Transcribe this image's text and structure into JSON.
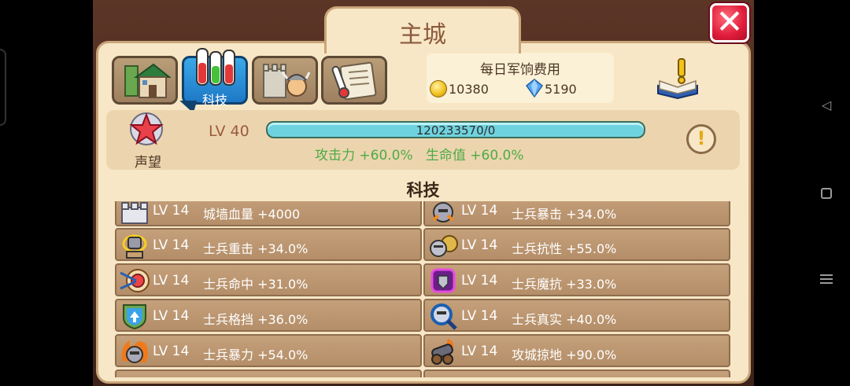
{
  "window": {
    "title": "主城",
    "close_label": "✕"
  },
  "tabs": [
    {
      "name": "castle",
      "label": ""
    },
    {
      "name": "tech",
      "label": "科技",
      "selected": true
    },
    {
      "name": "heroes",
      "label": ""
    },
    {
      "name": "notes",
      "label": ""
    }
  ],
  "cost": {
    "title": "每日军饷费用",
    "gold": "10380",
    "gems": "5190"
  },
  "prestige": {
    "label": "声望",
    "level": "LV 40",
    "progress_text": "120233570/0",
    "progress_fraction": 1.0,
    "bonus": "攻击力 +60.0%   生命值 +60.0%"
  },
  "section_title": "科技",
  "tech_items": [
    {
      "level": "LV 14",
      "name": "城墙血量 +4000",
      "icon": "castle-wall-icon"
    },
    {
      "level": "LV 14",
      "name": "士兵暴击 +34.0%",
      "icon": "knight-crit-icon"
    },
    {
      "level": "LV 14",
      "name": "士兵重击 +34.0%",
      "icon": "hammer-fist-icon"
    },
    {
      "level": "LV 14",
      "name": "士兵抗性 +55.0%",
      "icon": "armor-icon"
    },
    {
      "level": "LV 14",
      "name": "士兵命中 +31.0%",
      "icon": "target-arrows-icon"
    },
    {
      "level": "LV 14",
      "name": "士兵魔抗 +33.0%",
      "icon": "magic-shield-icon"
    },
    {
      "level": "LV 14",
      "name": "士兵格挡 +36.0%",
      "icon": "shield-icon"
    },
    {
      "level": "LV 14",
      "name": "士兵真实 +40.0%",
      "icon": "magnifier-knight-icon"
    },
    {
      "level": "LV 14",
      "name": "士兵暴力 +54.0%",
      "icon": "fire-knight-icon"
    },
    {
      "level": "LV 14",
      "name": "攻城掠地 +90.0%",
      "icon": "cannon-icon"
    }
  ],
  "colors": {
    "panel": "#f7e7c6",
    "row": "#b48e68",
    "bonus": "#4faa48",
    "level": "#9b5a42",
    "close": "#e01c3a",
    "tab_selected": "#1d78c6"
  }
}
